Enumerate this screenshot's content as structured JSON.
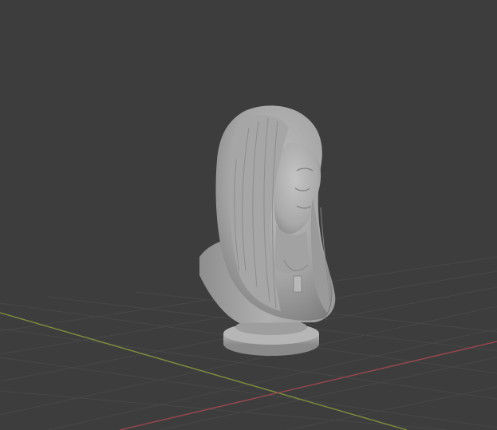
{
  "viewport": {
    "background_color": "#3d3d3d",
    "grid_color": "#484848",
    "x_axis_color": "#9b4750",
    "y_axis_color": "#7d8f3e",
    "model_color": "#a8a8a8",
    "object": "bust-sculpture"
  }
}
